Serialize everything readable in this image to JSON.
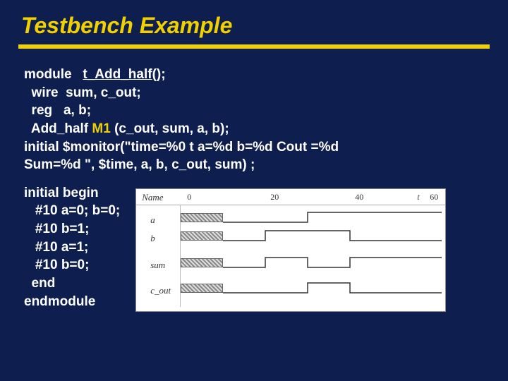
{
  "title": "Testbench Example",
  "code": {
    "l1a": "module",
    "l1b": "t_Add_half",
    "l1c": "();",
    "l2": "  wire  sum, c_out;",
    "l3": "  reg   a, b;",
    "l4a": "  Add_half",
    "l4b": "M1",
    "l4c": "(c_out, sum, a, b);",
    "l5": "initial $monitor(\"time=%0 t a=%d b=%d Cout =%d",
    "l6": " Sum=%d \", $time, a, b, c_out, sum) ;",
    "b1": "initial begin",
    "b2": "   #10 a=0; b=0;",
    "b3": "   #10 b=1;",
    "b4": "   #10 a=1;",
    "b5": "   #10 b=0;",
    "b6": "  end",
    "b7": "endmodule"
  },
  "wave": {
    "name_header": "Name",
    "ticks": [
      "0",
      "20",
      "40",
      "t",
      "60"
    ],
    "signals": [
      "a",
      "b",
      "sum",
      "c_out"
    ]
  },
  "chart_data": {
    "type": "line",
    "title": "",
    "xlabel": "t",
    "ylabel": "",
    "xlim": [
      0,
      60
    ],
    "categories": [
      0,
      10,
      20,
      30,
      40,
      50,
      60
    ],
    "series": [
      {
        "name": "a",
        "values": [
          null,
          0,
          0,
          1,
          1,
          1,
          1
        ]
      },
      {
        "name": "b",
        "values": [
          null,
          0,
          1,
          1,
          0,
          0,
          0
        ]
      },
      {
        "name": "sum",
        "values": [
          null,
          0,
          1,
          0,
          1,
          1,
          1
        ]
      },
      {
        "name": "c_out",
        "values": [
          null,
          0,
          0,
          1,
          0,
          0,
          0
        ]
      }
    ]
  }
}
